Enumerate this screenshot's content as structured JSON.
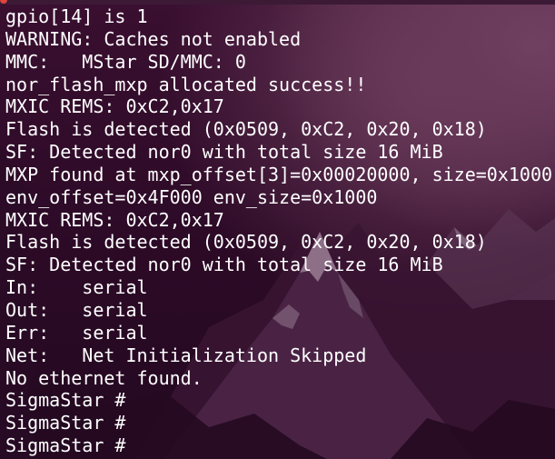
{
  "window": {
    "title": "~ — ~ — — ~ —"
  },
  "terminal": {
    "lines": [
      "gpio[14] is 1",
      "WARNING: Caches not enabled",
      "MMC:   MStar SD/MMC: 0",
      "nor_flash_mxp allocated success!!",
      "MXIC REMS: 0xC2,0x17",
      "Flash is detected (0x0509, 0xC2, 0x20, 0x18)",
      "SF: Detected nor0 with total size 16 MiB",
      "MXP found at mxp_offset[3]=0x00020000, size=0x1000",
      "env_offset=0x4F000 env_size=0x1000",
      "MXIC REMS: 0xC2,0x17",
      "Flash is detected (0x0509, 0xC2, 0x20, 0x18)",
      "SF: Detected nor0 with total size 16 MiB",
      "In:    serial",
      "Out:   serial",
      "Err:   serial",
      "Net:   Net Initialization Skipped",
      "No ethernet found.",
      "SigmaStar #",
      "SigmaStar #",
      "SigmaStar #"
    ]
  },
  "colors": {
    "background": "#2e0b28",
    "text": "#ffffff",
    "close_button": "#e0453a"
  }
}
